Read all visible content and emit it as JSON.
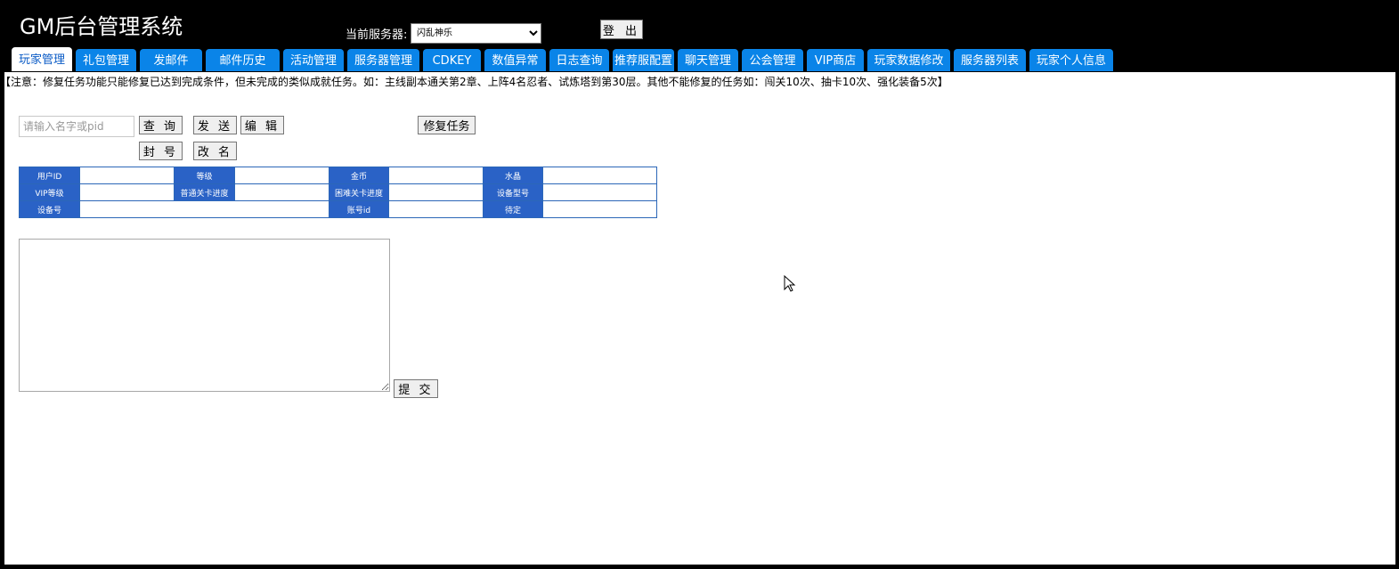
{
  "header": {
    "title": "GM后台管理系统",
    "server_label": "当前服务器:",
    "server_selected": "闪乱神乐",
    "logout_label": "登 出"
  },
  "tabs": [
    {
      "label": "玩家管理",
      "active": true
    },
    {
      "label": "礼包管理"
    },
    {
      "label": "发邮件"
    },
    {
      "label": "邮件历史"
    },
    {
      "label": "活动管理"
    },
    {
      "label": "服务器管理"
    },
    {
      "label": "CDKEY"
    },
    {
      "label": "数值异常"
    },
    {
      "label": "日志查询"
    },
    {
      "label": "推荐服配置"
    },
    {
      "label": "聊天管理"
    },
    {
      "label": "公会管理"
    },
    {
      "label": "VIP商店"
    },
    {
      "label": "玩家数据修改"
    },
    {
      "label": "服务器列表"
    },
    {
      "label": "玩家个人信息"
    }
  ],
  "main": {
    "notice": "【注意：修复任务功能只能修复已达到完成条件，但未完成的类似成就任务。如：主线副本通关第2章、上阵4名忍者、试炼塔到第30层。其他不能修复的任务如：闯关10次、抽卡10次、强化装备5次】",
    "search_placeholder": "请输入名字或pid",
    "buttons": {
      "query": "查 询",
      "send": "发 送",
      "edit": "编 辑",
      "repair_task": "修复任务",
      "ban": "封 号",
      "rename": "改 名",
      "submit": "提 交"
    },
    "info_table": {
      "rows": [
        [
          "用户ID",
          "",
          "等级",
          "",
          "金币",
          "",
          "水晶",
          ""
        ],
        [
          "VIP等级",
          "",
          "普通关卡进度",
          "",
          "困难关卡进度",
          "",
          "设备型号",
          ""
        ],
        [
          "设备号",
          "",
          "账号id",
          "",
          "待定",
          ""
        ]
      ]
    }
  },
  "colors": {
    "tab_bg": "#0a84e8",
    "table_header_bg": "#2a62c6"
  }
}
